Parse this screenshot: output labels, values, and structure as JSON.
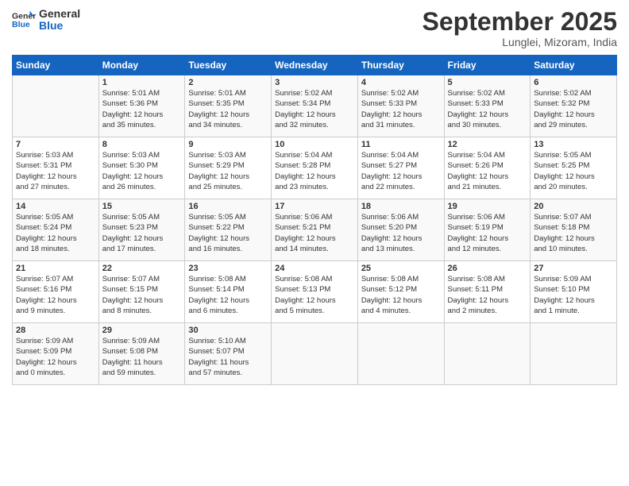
{
  "header": {
    "logo_line1": "General",
    "logo_line2": "Blue",
    "month": "September 2025",
    "location": "Lunglei, Mizoram, India"
  },
  "weekdays": [
    "Sunday",
    "Monday",
    "Tuesday",
    "Wednesday",
    "Thursday",
    "Friday",
    "Saturday"
  ],
  "weeks": [
    [
      {
        "day": "",
        "info": ""
      },
      {
        "day": "1",
        "info": "Sunrise: 5:01 AM\nSunset: 5:36 PM\nDaylight: 12 hours\nand 35 minutes."
      },
      {
        "day": "2",
        "info": "Sunrise: 5:01 AM\nSunset: 5:35 PM\nDaylight: 12 hours\nand 34 minutes."
      },
      {
        "day": "3",
        "info": "Sunrise: 5:02 AM\nSunset: 5:34 PM\nDaylight: 12 hours\nand 32 minutes."
      },
      {
        "day": "4",
        "info": "Sunrise: 5:02 AM\nSunset: 5:33 PM\nDaylight: 12 hours\nand 31 minutes."
      },
      {
        "day": "5",
        "info": "Sunrise: 5:02 AM\nSunset: 5:33 PM\nDaylight: 12 hours\nand 30 minutes."
      },
      {
        "day": "6",
        "info": "Sunrise: 5:02 AM\nSunset: 5:32 PM\nDaylight: 12 hours\nand 29 minutes."
      }
    ],
    [
      {
        "day": "7",
        "info": "Sunrise: 5:03 AM\nSunset: 5:31 PM\nDaylight: 12 hours\nand 27 minutes."
      },
      {
        "day": "8",
        "info": "Sunrise: 5:03 AM\nSunset: 5:30 PM\nDaylight: 12 hours\nand 26 minutes."
      },
      {
        "day": "9",
        "info": "Sunrise: 5:03 AM\nSunset: 5:29 PM\nDaylight: 12 hours\nand 25 minutes."
      },
      {
        "day": "10",
        "info": "Sunrise: 5:04 AM\nSunset: 5:28 PM\nDaylight: 12 hours\nand 23 minutes."
      },
      {
        "day": "11",
        "info": "Sunrise: 5:04 AM\nSunset: 5:27 PM\nDaylight: 12 hours\nand 22 minutes."
      },
      {
        "day": "12",
        "info": "Sunrise: 5:04 AM\nSunset: 5:26 PM\nDaylight: 12 hours\nand 21 minutes."
      },
      {
        "day": "13",
        "info": "Sunrise: 5:05 AM\nSunset: 5:25 PM\nDaylight: 12 hours\nand 20 minutes."
      }
    ],
    [
      {
        "day": "14",
        "info": "Sunrise: 5:05 AM\nSunset: 5:24 PM\nDaylight: 12 hours\nand 18 minutes."
      },
      {
        "day": "15",
        "info": "Sunrise: 5:05 AM\nSunset: 5:23 PM\nDaylight: 12 hours\nand 17 minutes."
      },
      {
        "day": "16",
        "info": "Sunrise: 5:05 AM\nSunset: 5:22 PM\nDaylight: 12 hours\nand 16 minutes."
      },
      {
        "day": "17",
        "info": "Sunrise: 5:06 AM\nSunset: 5:21 PM\nDaylight: 12 hours\nand 14 minutes."
      },
      {
        "day": "18",
        "info": "Sunrise: 5:06 AM\nSunset: 5:20 PM\nDaylight: 12 hours\nand 13 minutes."
      },
      {
        "day": "19",
        "info": "Sunrise: 5:06 AM\nSunset: 5:19 PM\nDaylight: 12 hours\nand 12 minutes."
      },
      {
        "day": "20",
        "info": "Sunrise: 5:07 AM\nSunset: 5:18 PM\nDaylight: 12 hours\nand 10 minutes."
      }
    ],
    [
      {
        "day": "21",
        "info": "Sunrise: 5:07 AM\nSunset: 5:16 PM\nDaylight: 12 hours\nand 9 minutes."
      },
      {
        "day": "22",
        "info": "Sunrise: 5:07 AM\nSunset: 5:15 PM\nDaylight: 12 hours\nand 8 minutes."
      },
      {
        "day": "23",
        "info": "Sunrise: 5:08 AM\nSunset: 5:14 PM\nDaylight: 12 hours\nand 6 minutes."
      },
      {
        "day": "24",
        "info": "Sunrise: 5:08 AM\nSunset: 5:13 PM\nDaylight: 12 hours\nand 5 minutes."
      },
      {
        "day": "25",
        "info": "Sunrise: 5:08 AM\nSunset: 5:12 PM\nDaylight: 12 hours\nand 4 minutes."
      },
      {
        "day": "26",
        "info": "Sunrise: 5:08 AM\nSunset: 5:11 PM\nDaylight: 12 hours\nand 2 minutes."
      },
      {
        "day": "27",
        "info": "Sunrise: 5:09 AM\nSunset: 5:10 PM\nDaylight: 12 hours\nand 1 minute."
      }
    ],
    [
      {
        "day": "28",
        "info": "Sunrise: 5:09 AM\nSunset: 5:09 PM\nDaylight: 12 hours\nand 0 minutes."
      },
      {
        "day": "29",
        "info": "Sunrise: 5:09 AM\nSunset: 5:08 PM\nDaylight: 11 hours\nand 59 minutes."
      },
      {
        "day": "30",
        "info": "Sunrise: 5:10 AM\nSunset: 5:07 PM\nDaylight: 11 hours\nand 57 minutes."
      },
      {
        "day": "",
        "info": ""
      },
      {
        "day": "",
        "info": ""
      },
      {
        "day": "",
        "info": ""
      },
      {
        "day": "",
        "info": ""
      }
    ]
  ]
}
